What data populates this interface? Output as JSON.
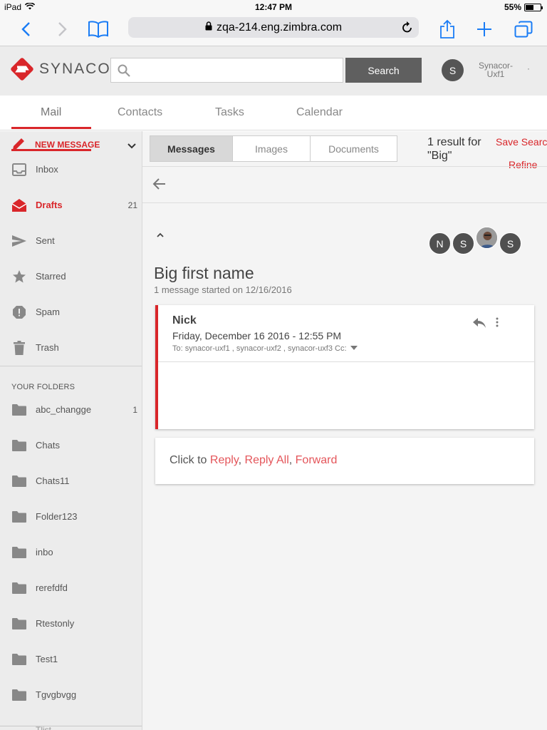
{
  "status_bar": {
    "device": "iPad",
    "time": "12:47 PM",
    "battery": "55%",
    "battery_level": 0.55
  },
  "browser": {
    "url": "zqa-214.eng.zimbra.com"
  },
  "header": {
    "logo_text": "SYNACO",
    "search_placeholder": "",
    "search_button": "Search",
    "avatar_initial": "S",
    "user_name": "Synacor-Uxf1",
    "user_dot": "·"
  },
  "nav_tabs": [
    "Mail",
    "Contacts",
    "Tasks",
    "Calendar"
  ],
  "sidebar": {
    "new_message": "NEW MESSAGE",
    "items": [
      {
        "label": "Inbox",
        "icon": "inbox-icon",
        "count": ""
      },
      {
        "label": "Drafts",
        "icon": "drafts-icon",
        "count": "21",
        "active": true
      },
      {
        "label": "Sent",
        "icon": "sent-icon",
        "count": ""
      },
      {
        "label": "Starred",
        "icon": "star-icon",
        "count": ""
      },
      {
        "label": "Spam",
        "icon": "spam-icon",
        "count": ""
      },
      {
        "label": "Trash",
        "icon": "trash-icon",
        "count": ""
      }
    ],
    "folders_title": "YOUR FOLDERS",
    "folders": [
      {
        "label": "abc_changge",
        "count": "1"
      },
      {
        "label": "Chats",
        "count": ""
      },
      {
        "label": "Chats11",
        "count": ""
      },
      {
        "label": "Folder123",
        "count": ""
      },
      {
        "label": "inbo",
        "count": ""
      },
      {
        "label": "rerefdfd",
        "count": ""
      },
      {
        "label": "Rtestonly",
        "count": ""
      },
      {
        "label": "Test1",
        "count": ""
      },
      {
        "label": "Tgvgbvgg",
        "count": ""
      }
    ],
    "cut_folder": "Tlist"
  },
  "search_results": {
    "tabs": [
      "Messages",
      "Images",
      "Documents"
    ],
    "result_count": "1 result for \"Big\"",
    "save_search": "Save Search",
    "refine": "Refine"
  },
  "conversation": {
    "title": "Big first name",
    "subtitle": "1 message started on 12/16/2016",
    "participants": [
      "N",
      "S",
      "photo",
      "S"
    ],
    "message": {
      "from": "Nick",
      "date": "Friday, December 16 2016 - 12:55 PM",
      "to": "To: synacor-uxf1 , synacor-uxf2 , synacor-uxf3 Cc:"
    },
    "reply": {
      "prefix": "Click to ",
      "reply": "Reply",
      "reply_all": "Reply All",
      "forward": "Forward",
      "sep": ", "
    }
  },
  "colors": {
    "brand_red": "#d9262a",
    "link_red": "#e4555a",
    "ios_blue": "#1a7cf5"
  }
}
